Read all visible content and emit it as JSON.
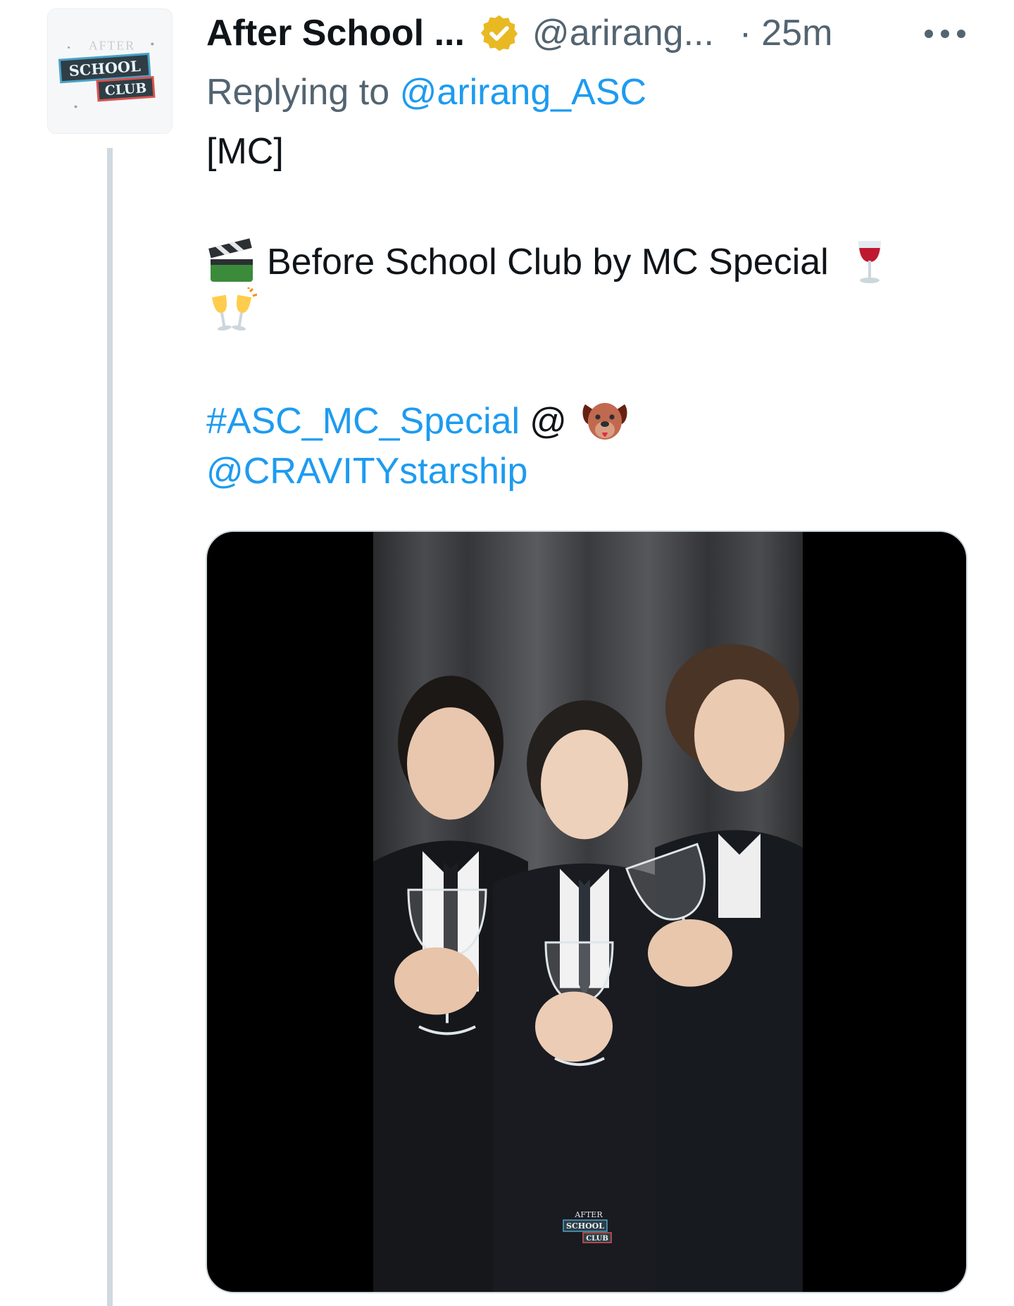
{
  "tweet": {
    "avatar_icon": "after-school-club-logo",
    "display_name": "After School ...",
    "verified_icon": "verified-badge-gold",
    "handle": "@arirang...",
    "separator": "·",
    "time": "25m",
    "more_icon": "more-horizontal-icon",
    "replying_prefix": "Replying to",
    "replying_to": "@arirang_ASC",
    "line1": "[MC]",
    "line2": "Before School Club by MC Special",
    "line2_leading_emoji": "clapper-board",
    "line2_trailing_emojis": [
      "wine-glass",
      "clinking-glasses"
    ],
    "hashtag": "#ASC_MC_Special",
    "at_symbol": "@",
    "dog_emoji": "dog-face",
    "mention": "@CRAVITYstarship",
    "media": {
      "type": "video",
      "description_icon": "video-thumbnail",
      "watermark_icon": "after-school-club-watermark"
    }
  },
  "colors": {
    "text_primary": "#0f1419",
    "text_secondary": "#536471",
    "link": "#1d9bf0",
    "thread_line": "#cfd9de",
    "verified_gold": "#e8b923"
  }
}
